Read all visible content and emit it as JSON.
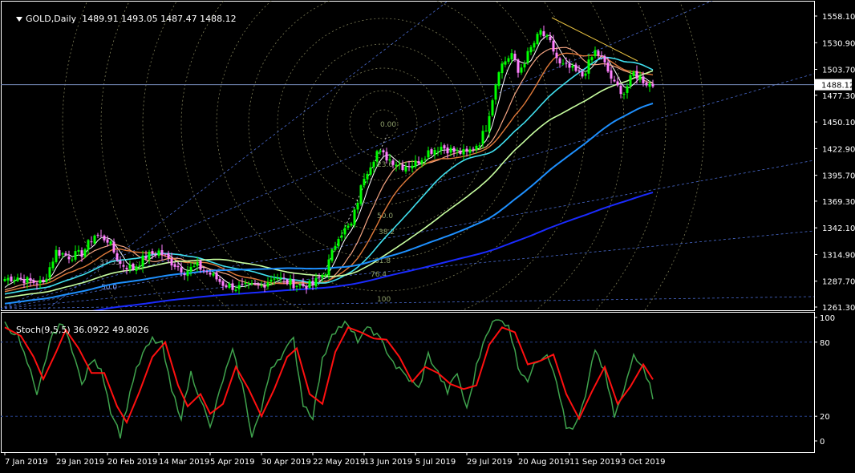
{
  "header": {
    "symbol": "GOLD,Daily",
    "ohlc": "1489.91 1493.05 1487.47 1488.12"
  },
  "stoch_header": {
    "label": "Stoch(9,5,5) 36.0922 49.8026"
  },
  "colors": {
    "background": "#000000",
    "axis": "#ffffff",
    "grid_dash": "#27408b",
    "bull_candle": "#00ff00",
    "bear_candle": "#ff80ff",
    "ma_fast": "#ffffff",
    "ma_2": "#f4a582",
    "ma_3": "#e07a3a",
    "ma_4": "#40e0f0",
    "ma_5": "#c8ffa0",
    "ma_6": "#1e90ff",
    "ma_7": "#1a2bff",
    "stoch_main": "#3fa34d",
    "stoch_signal": "#ff1010",
    "fib_circle": "#9b9b6b",
    "fan_line": "#4a6bd0",
    "trend_line": "#e6c040",
    "price_line": "#7a8fc0"
  },
  "chart_data": [
    {
      "type": "candlestick",
      "title": "GOLD,Daily",
      "ylim": [
        1255,
        1568
      ],
      "yticks": [
        "1558.10",
        "1530.90",
        "1503.70",
        "1477.30",
        "1450.10",
        "1422.90",
        "1395.70",
        "1369.30",
        "1342.10",
        "1314.90",
        "1287.70",
        "1261.30"
      ],
      "ytick_values": [
        1558.1,
        1530.9,
        1503.7,
        1477.3,
        1450.1,
        1422.9,
        1395.7,
        1369.3,
        1342.1,
        1314.9,
        1287.7,
        1261.3
      ],
      "current_price": "1488.12",
      "current_price_value": 1488.12,
      "x_labels": [
        "7 Jan 2019",
        "29 Jan 2019",
        "20 Feb 2019",
        "14 Mar 2019",
        "5 Apr 2019",
        "30 Apr 2019",
        "22 May 2019",
        "13 Jun 2019",
        "5 Jul 2019",
        "29 Jul 2019",
        "20 Aug 2019",
        "11 Sep 2019",
        "3 Oct 2019"
      ],
      "x_label_index": [
        0,
        16,
        32,
        48,
        64,
        80,
        96,
        112,
        128,
        144,
        160,
        176,
        192
      ],
      "close_anchors": [
        [
          0,
          1290
        ],
        [
          4,
          1292
        ],
        [
          8,
          1287
        ],
        [
          12,
          1286
        ],
        [
          16,
          1318
        ],
        [
          20,
          1313
        ],
        [
          24,
          1316
        ],
        [
          28,
          1335
        ],
        [
          32,
          1330
        ],
        [
          36,
          1305
        ],
        [
          40,
          1301
        ],
        [
          44,
          1313
        ],
        [
          48,
          1318
        ],
        [
          52,
          1307
        ],
        [
          56,
          1298
        ],
        [
          60,
          1303
        ],
        [
          64,
          1295
        ],
        [
          68,
          1285
        ],
        [
          72,
          1281
        ],
        [
          76,
          1282
        ],
        [
          80,
          1283
        ],
        [
          84,
          1293
        ],
        [
          88,
          1287
        ],
        [
          92,
          1283
        ],
        [
          96,
          1284
        ],
        [
          100,
          1298
        ],
        [
          104,
          1335
        ],
        [
          108,
          1345
        ],
        [
          112,
          1395
        ],
        [
          116,
          1420
        ],
        [
          120,
          1412
        ],
        [
          124,
          1405
        ],
        [
          128,
          1408
        ],
        [
          132,
          1420
        ],
        [
          136,
          1425
        ],
        [
          140,
          1420
        ],
        [
          144,
          1418
        ],
        [
          148,
          1430
        ],
        [
          150,
          1445
        ],
        [
          154,
          1505
        ],
        [
          158,
          1520
        ],
        [
          160,
          1500
        ],
        [
          164,
          1525
        ],
        [
          167,
          1542
        ],
        [
          170,
          1530
        ],
        [
          173,
          1508
        ],
        [
          176,
          1505
        ],
        [
          180,
          1497
        ],
        [
          184,
          1522
        ],
        [
          186,
          1515
        ],
        [
          190,
          1488
        ],
        [
          193,
          1480
        ],
        [
          196,
          1500
        ],
        [
          198,
          1495
        ],
        [
          200,
          1490
        ],
        [
          202,
          1488
        ]
      ],
      "ma_periods": [
        5,
        13,
        21,
        34,
        55,
        89,
        200
      ],
      "fib_labels": [
        "0.00",
        "23.6",
        "38.2",
        "50.0",
        "61.8",
        "76.4",
        "100"
      ],
      "fan_labels": [
        "33.33",
        "50.0"
      ],
      "stochastic": {
        "title": "Stoch(9,5,5)",
        "main_value": 36.0922,
        "signal_value": 49.8026,
        "ylim": [
          0,
          100
        ],
        "yticks": [
          "100",
          "80",
          "20",
          "0"
        ],
        "levels": [
          80,
          20
        ],
        "main_anchors": [
          [
            0,
            95
          ],
          [
            4,
            85
          ],
          [
            8,
            55
          ],
          [
            10,
            35
          ],
          [
            14,
            80
          ],
          [
            17,
            95
          ],
          [
            20,
            85
          ],
          [
            24,
            45
          ],
          [
            27,
            65
          ],
          [
            30,
            60
          ],
          [
            33,
            25
          ],
          [
            36,
            5
          ],
          [
            40,
            50
          ],
          [
            43,
            70
          ],
          [
            46,
            82
          ],
          [
            49,
            78
          ],
          [
            52,
            40
          ],
          [
            55,
            20
          ],
          [
            58,
            55
          ],
          [
            61,
            35
          ],
          [
            64,
            10
          ],
          [
            68,
            50
          ],
          [
            71,
            72
          ],
          [
            74,
            45
          ],
          [
            77,
            5
          ],
          [
            80,
            25
          ],
          [
            83,
            60
          ],
          [
            87,
            72
          ],
          [
            90,
            82
          ],
          [
            93,
            30
          ],
          [
            96,
            20
          ],
          [
            99,
            65
          ],
          [
            102,
            88
          ],
          [
            106,
            95
          ],
          [
            110,
            82
          ],
          [
            114,
            92
          ],
          [
            118,
            78
          ],
          [
            122,
            60
          ],
          [
            126,
            50
          ],
          [
            129,
            42
          ],
          [
            132,
            70
          ],
          [
            135,
            55
          ],
          [
            138,
            40
          ],
          [
            141,
            55
          ],
          [
            144,
            25
          ],
          [
            147,
            60
          ],
          [
            150,
            88
          ],
          [
            153,
            98
          ],
          [
            157,
            95
          ],
          [
            160,
            60
          ],
          [
            163,
            50
          ],
          [
            166,
            65
          ],
          [
            169,
            72
          ],
          [
            172,
            50
          ],
          [
            175,
            10
          ],
          [
            178,
            12
          ],
          [
            181,
            35
          ],
          [
            184,
            75
          ],
          [
            187,
            55
          ],
          [
            190,
            20
          ],
          [
            193,
            40
          ],
          [
            196,
            70
          ],
          [
            199,
            62
          ],
          [
            202,
            36
          ]
        ],
        "signal_anchors": [
          [
            0,
            92
          ],
          [
            5,
            85
          ],
          [
            9,
            68
          ],
          [
            12,
            50
          ],
          [
            16,
            72
          ],
          [
            19,
            90
          ],
          [
            23,
            75
          ],
          [
            27,
            55
          ],
          [
            31,
            55
          ],
          [
            35,
            28
          ],
          [
            38,
            15
          ],
          [
            42,
            40
          ],
          [
            46,
            68
          ],
          [
            50,
            80
          ],
          [
            54,
            45
          ],
          [
            57,
            28
          ],
          [
            61,
            38
          ],
          [
            64,
            22
          ],
          [
            68,
            30
          ],
          [
            72,
            60
          ],
          [
            76,
            42
          ],
          [
            80,
            20
          ],
          [
            84,
            42
          ],
          [
            88,
            68
          ],
          [
            91,
            75
          ],
          [
            95,
            38
          ],
          [
            99,
            30
          ],
          [
            103,
            72
          ],
          [
            107,
            92
          ],
          [
            111,
            88
          ],
          [
            115,
            83
          ],
          [
            119,
            82
          ],
          [
            123,
            68
          ],
          [
            127,
            48
          ],
          [
            131,
            60
          ],
          [
            135,
            55
          ],
          [
            139,
            46
          ],
          [
            143,
            42
          ],
          [
            147,
            45
          ],
          [
            151,
            78
          ],
          [
            155,
            92
          ],
          [
            159,
            88
          ],
          [
            163,
            62
          ],
          [
            167,
            65
          ],
          [
            171,
            70
          ],
          [
            175,
            38
          ],
          [
            179,
            18
          ],
          [
            183,
            40
          ],
          [
            187,
            60
          ],
          [
            191,
            30
          ],
          [
            195,
            44
          ],
          [
            199,
            62
          ],
          [
            202,
            49.8
          ]
        ]
      }
    }
  ]
}
